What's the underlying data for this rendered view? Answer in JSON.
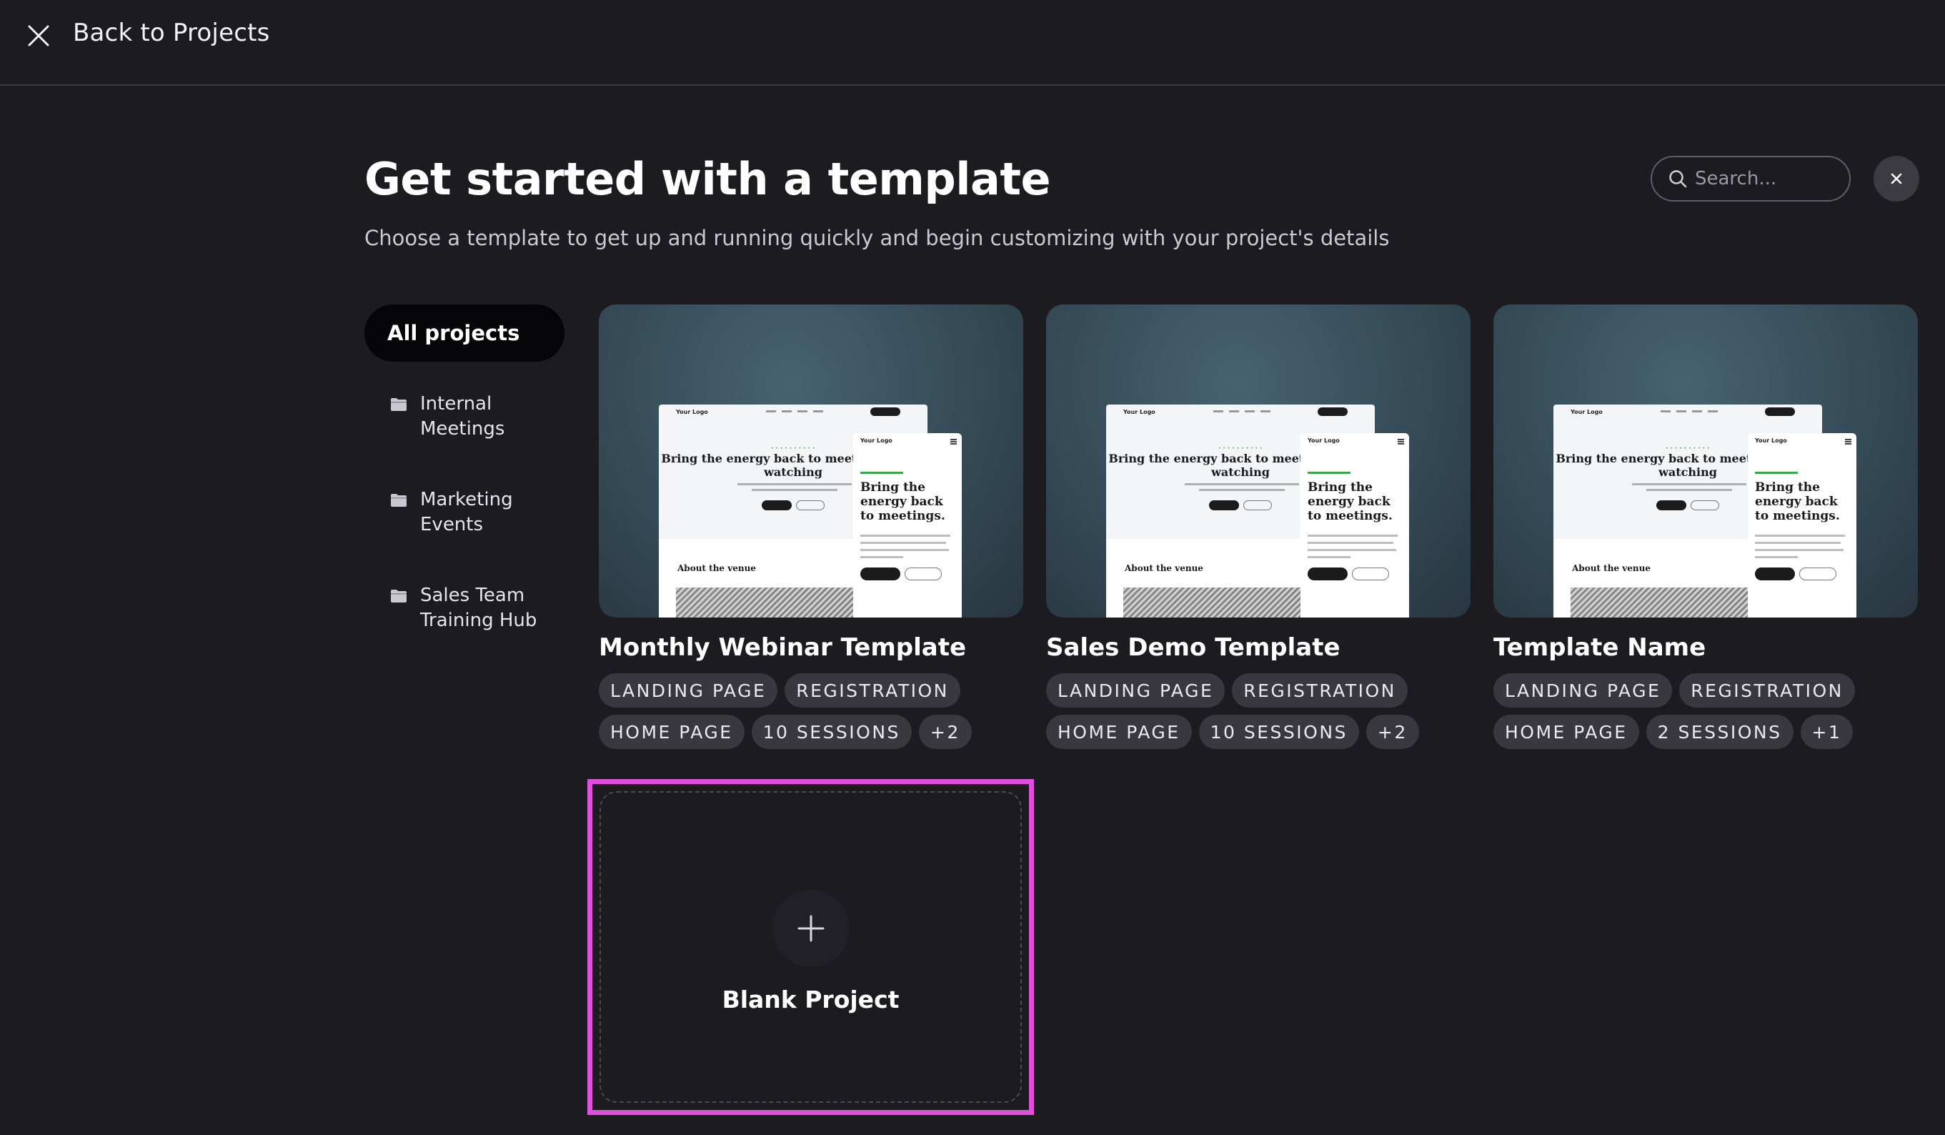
{
  "topbar": {
    "back_label": "Back to Projects"
  },
  "header": {
    "title": "Get started with a template",
    "subtitle": "Choose a template to get up and running quickly and begin customizing with your project's details",
    "search_placeholder": "Search..."
  },
  "sidebar": {
    "all_label": "All projects",
    "folders": [
      {
        "label": "Internal Meetings"
      },
      {
        "label": "Marketing Events"
      },
      {
        "label": "Sales Team Training Hub"
      }
    ]
  },
  "templates": [
    {
      "title": "Monthly Webinar Template",
      "tags": [
        "LANDING PAGE",
        "REGISTRATION",
        "HOME PAGE",
        "10 SESSIONS",
        "+2"
      ]
    },
    {
      "title": "Sales Demo Template",
      "tags": [
        "LANDING PAGE",
        "REGISTRATION",
        "HOME PAGE",
        "10 SESSIONS",
        "+2"
      ]
    },
    {
      "title": "Template Name",
      "tags": [
        "LANDING PAGE",
        "REGISTRATION",
        "HOME PAGE",
        "2 SESSIONS",
        "+1"
      ]
    }
  ],
  "mockup": {
    "logo": "Your Logo",
    "desktop_headline": "Bring the energy back to meetings worth watching",
    "mobile_headline": "Bring the energy back to meetings.",
    "venue_heading": "About the venue"
  },
  "blank_project": {
    "label": "Blank Project"
  },
  "colors": {
    "background": "#1b1b20",
    "highlight": "#e150dc",
    "tag_bg": "#38383e"
  }
}
